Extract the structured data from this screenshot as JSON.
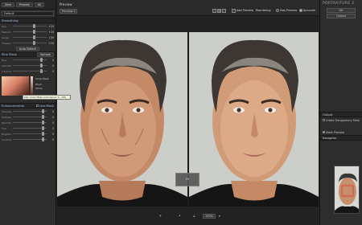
{
  "left_panel": {
    "top_buttons": [
      "Zero",
      "Presets",
      "All"
    ],
    "preset_select": "Default",
    "smoothing_title": "Smoothing",
    "smooth_sliders": [
      {
        "label": "Fine",
        "value": "+20"
      },
      {
        "label": "Medium",
        "value": "+20"
      },
      {
        "label": "Large",
        "value": "+20"
      },
      {
        "label": "Threshold",
        "value": "+20"
      }
    ],
    "auto_detect": "Auto Detect",
    "mask_title": "Skin Mask",
    "mask_sample": "Sample",
    "mask_sliders": [
      {
        "label": "Hue",
        "value": "0"
      },
      {
        "label": "Saturation",
        "value": "0"
      },
      {
        "label": "Luminance",
        "value": "0"
      }
    ],
    "show_mask": "Show Mask",
    "mask_options": [
      "Black",
      "White"
    ],
    "tooltip": "Skin Color Mask Luminance: 0 - 100",
    "enhance_title": "Enhancements",
    "use_mask": "Use Mask",
    "enhance_sliders": [
      {
        "label": "Sharpness",
        "value": "0"
      },
      {
        "label": "Softness",
        "value": "0"
      },
      {
        "label": "Warmth",
        "value": "0"
      },
      {
        "label": "Tint",
        "value": "0"
      },
      {
        "label": "Brightness",
        "value": "0"
      },
      {
        "label": "Contrast",
        "value": "0"
      }
    ]
  },
  "center": {
    "title": "Preview",
    "preset_tag": "Preview 1",
    "toolbar": [
      "Add Preview",
      "Reordering",
      "Fast Preview",
      "Accurate"
    ],
    "handle_label": "Fit",
    "zoom": "100%"
  },
  "right_panel": {
    "app_title": "PORTRAITURE 2",
    "ok_label": "OK",
    "cancel_label": "Cancel",
    "output_title": "Output",
    "output_option": "Create Transparency Mask",
    "preview_mode": "Mask Preview",
    "navigator_title": "Navigator"
  },
  "colors": {
    "panel": "#2d2d2d",
    "accent": "#9cc1e6",
    "mask_swatch": "#d9826a"
  }
}
